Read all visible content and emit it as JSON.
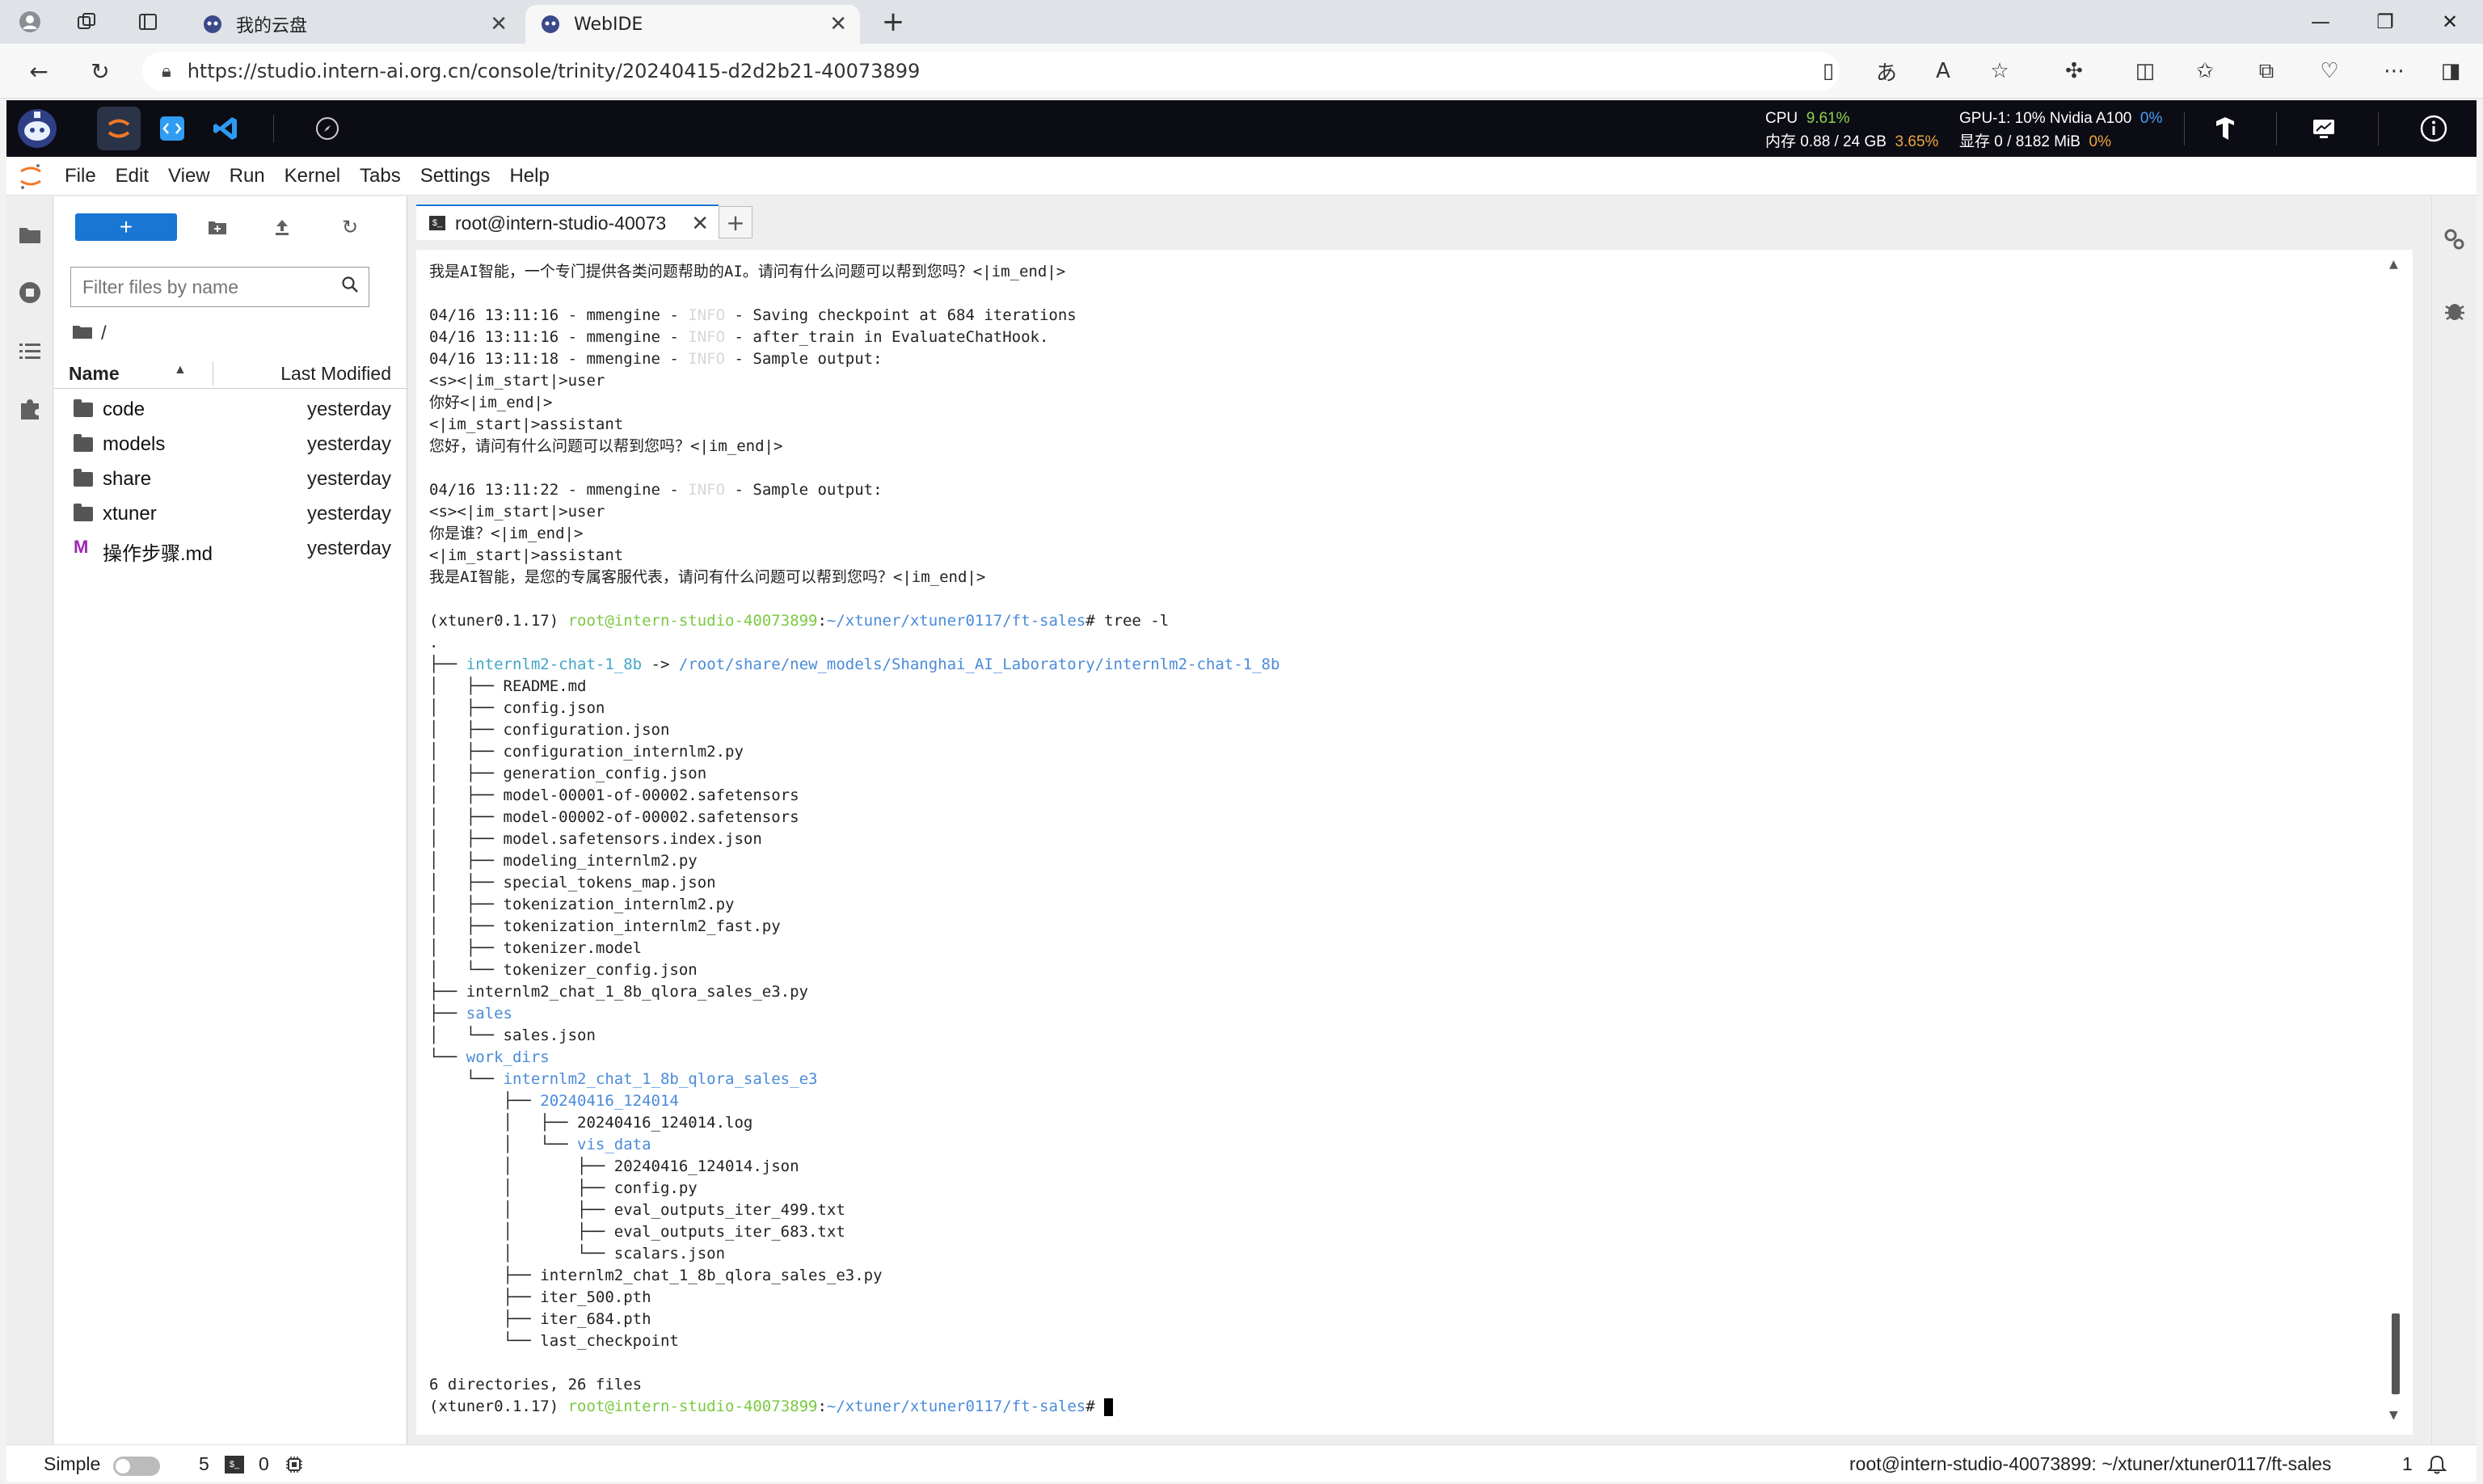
{
  "browser": {
    "tabs": [
      {
        "title": "我的云盘"
      },
      {
        "title": "WebIDE"
      }
    ],
    "new_tab": "+",
    "url": "https://studio.intern-ai.org.cn/console/trinity/20240415-d2d2b21-40073899"
  },
  "studio": {
    "cpu_label": "CPU",
    "cpu_value": "9.61%",
    "mem_label": "内存",
    "mem_value": "0.88 / 24 GB",
    "mem_pct": "3.65%",
    "gpu_label": "GPU-1: 10% Nvidia A100",
    "gpu_pct": "0%",
    "vram_label": "显存",
    "vram_value": "0 / 8182 MiB",
    "vram_pct": "0%"
  },
  "menu": [
    "File",
    "Edit",
    "View",
    "Run",
    "Kernel",
    "Tabs",
    "Settings",
    "Help"
  ],
  "filebrowser": {
    "new_label": "+",
    "filter_placeholder": "Filter files by name",
    "breadcrumb": "/",
    "col_name": "Name",
    "col_modified": "Last Modified",
    "items": [
      {
        "name": "code",
        "modified": "yesterday",
        "type": "folder"
      },
      {
        "name": "models",
        "modified": "yesterday",
        "type": "folder"
      },
      {
        "name": "share",
        "modified": "yesterday",
        "type": "folder"
      },
      {
        "name": "xtuner",
        "modified": "yesterday",
        "type": "folder"
      },
      {
        "name": "操作步骤.md",
        "modified": "yesterday",
        "type": "markdown"
      }
    ]
  },
  "terminal": {
    "tab_title": "root@intern-studio-40073",
    "lines": [
      "我是AI智能，一个专门提供各类问题帮助的AI。请问有什么问题可以帮到您吗？<|im_end|>",
      "",
      "04/16 13:11:16 - mmengine - INFO - Saving checkpoint at 684 iterations",
      "04/16 13:11:16 - mmengine - INFO - after_train in EvaluateChatHook.",
      "04/16 13:11:18 - mmengine - INFO - Sample output:",
      "<s><|im_start|>user",
      "你好<|im_end|>",
      "<|im_start|>assistant",
      "您好，请问有什么问题可以帮到您吗？<|im_end|>",
      "",
      "04/16 13:11:22 - mmengine - INFO - Sample output:",
      "<s><|im_start|>user",
      "你是谁？<|im_end|>",
      "<|im_start|>assistant",
      "我是AI智能，是您的专属客服代表，请问有什么问题可以帮到您吗？<|im_end|>",
      "",
      "(xtuner0.1.17) root@intern-studio-40073899:~/xtuner/xtuner0117/ft-sales# tree -l",
      ".",
      "├── internlm2-chat-1_8b -> /root/share/new_models/Shanghai_AI_Laboratory/internlm2-chat-1_8b",
      "│   ├── README.md",
      "│   ├── config.json",
      "│   ├── configuration.json",
      "│   ├── configuration_internlm2.py",
      "│   ├── generation_config.json",
      "│   ├── model-00001-of-00002.safetensors",
      "│   ├── model-00002-of-00002.safetensors",
      "│   ├── model.safetensors.index.json",
      "│   ├── modeling_internlm2.py",
      "│   ├── special_tokens_map.json",
      "│   ├── tokenization_internlm2.py",
      "│   ├── tokenization_internlm2_fast.py",
      "│   ├── tokenizer.model",
      "│   └── tokenizer_config.json",
      "├── internlm2_chat_1_8b_qlora_sales_e3.py",
      "├── sales",
      "│   └── sales.json",
      "└── work_dirs",
      "    └── internlm2_chat_1_8b_qlora_sales_e3",
      "        ├── 20240416_124014",
      "        │   ├── 20240416_124014.log",
      "        │   └── vis_data",
      "        │       ├── 20240416_124014.json",
      "        │       ├── config.py",
      "        │       ├── eval_outputs_iter_499.txt",
      "        │       ├── eval_outputs_iter_683.txt",
      "        │       └── scalars.json",
      "        ├── internlm2_chat_1_8b_qlora_sales_e3.py",
      "        ├── iter_500.pth",
      "        ├── iter_684.pth",
      "        └── last_checkpoint",
      "",
      "6 directories, 26 files",
      "(xtuner0.1.17) root@intern-studio-40073899:~/xtuner/xtuner0117/ft-sales# "
    ]
  },
  "statusbar": {
    "mode": "Simple",
    "terminals": "5",
    "kernels": "0",
    "path": "root@intern-studio-40073899: ~/xtuner/xtuner0117/ft-sales",
    "notifications": "1"
  }
}
